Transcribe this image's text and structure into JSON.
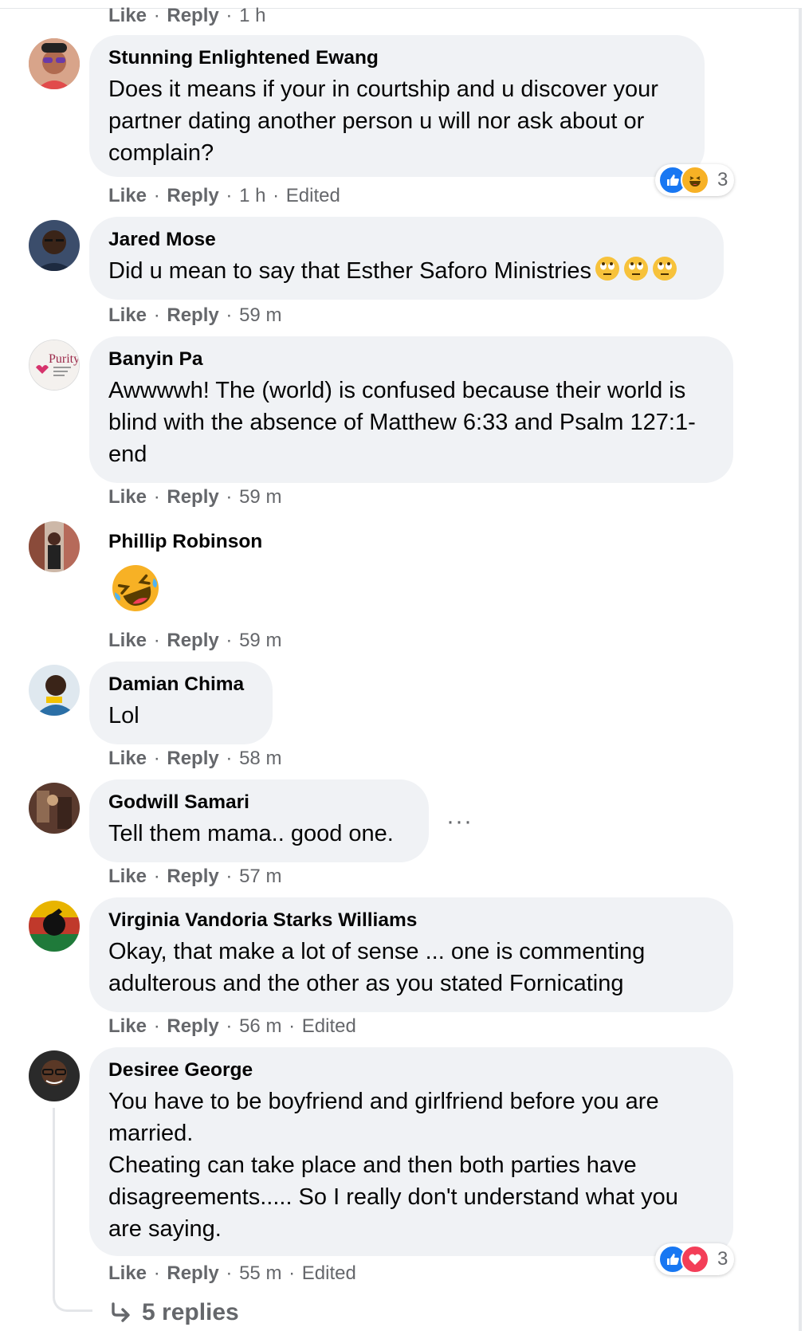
{
  "labels": {
    "like": "Like",
    "reply": "Reply",
    "dot": "·",
    "edited": "Edited"
  },
  "top_meta": {
    "time": "1 h"
  },
  "comments": [
    {
      "author": "Stunning Enlightened Ewang",
      "text": "Does it means if your in courtship and u discover your partner dating another person u will nor ask about or complain?",
      "time": "1 h",
      "edited": true,
      "reactions": {
        "types": [
          "like-icon",
          "haha-icon"
        ],
        "count": "3"
      }
    },
    {
      "author": "Jared Mose",
      "text": "Did u mean to say that Esther Saforo Ministries",
      "emoji_suffix": [
        "rolling-eyes-icon",
        "rolling-eyes-icon",
        "rolling-eyes-icon"
      ],
      "time": "59 m"
    },
    {
      "author": "Banyin Pa",
      "avatar_text": "Purity",
      "text": "Awwwwh! The (world) is confused because their world is blind with the absence of Matthew 6:33 and Psalm 127:1- end",
      "time": "59 m"
    },
    {
      "author": "Phillip Robinson",
      "emoji_only": "rolling-laughing-icon",
      "time": "59 m"
    },
    {
      "author": "Damian Chima",
      "text": "Lol",
      "time": "58 m"
    },
    {
      "author": "Godwill Samari",
      "text": "Tell them mama.. good one.",
      "more": "···",
      "time": "57 m"
    },
    {
      "author": "Virginia Vandoria Starks Williams",
      "text": "Okay, that make a lot of sense ... one is commenting adulterous and the other as you stated Fornicating",
      "time": "56 m",
      "edited": true
    },
    {
      "author": "Desiree George",
      "text": "You have to be boyfriend and girlfriend before you are married.\nCheating can take place and then both parties have disagreements..... So I really don't understand what you are saying.",
      "time": "55 m",
      "edited": true,
      "reactions": {
        "types": [
          "like-icon",
          "love-icon"
        ],
        "count": "3"
      }
    }
  ],
  "replies_link": {
    "label": "5 replies"
  },
  "colors": {
    "bubble": "#f0f2f5",
    "meta_text": "#65676b",
    "like_blue": "#1877f2",
    "love_red": "#f33e58",
    "haha_yellow": "#f7b125"
  }
}
